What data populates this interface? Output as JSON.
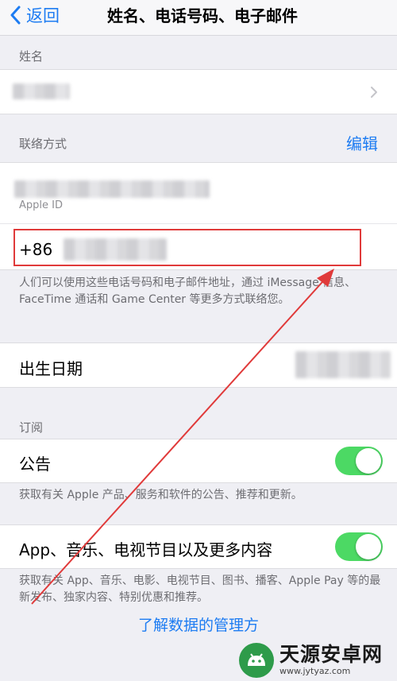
{
  "nav": {
    "back_label": "返回",
    "title": "姓名、电话号码、电子邮件"
  },
  "name_section": {
    "header": "姓名"
  },
  "contact_section": {
    "header": "联络方式",
    "edit_label": "编辑",
    "apple_id_label": "Apple ID",
    "phone_prefix": "+86",
    "footnote": "人们可以使用这些电话号码和电子邮件地址，通过 iMessage 信息、FaceTime 通话和 Game Center 等更多方式联络您。"
  },
  "birthday": {
    "label": "出生日期"
  },
  "subscription_section": {
    "header": "订阅",
    "announcements": {
      "label": "公告",
      "enabled": true,
      "footnote": "获取有关 Apple 产品、服务和软件的公告、推荐和更新。"
    },
    "apps_music": {
      "label": "App、音乐、电视节目以及更多内容",
      "enabled": true,
      "footnote": "获取有关 App、音乐、电影、电视节目、图书、播客、Apple Pay 等的最新发布、独家内容、特别优惠和推荐。"
    }
  },
  "data_link": {
    "label": "了解数据的管理方"
  },
  "watermark": {
    "name": "天源安卓网",
    "url": "www.jytyaz.com"
  },
  "colors": {
    "accent": "#1d7cf2",
    "toggle_on": "#4cd964",
    "annotation": "#e03a3a",
    "background": "#efeff4"
  },
  "icons": [
    "chevron-left-icon",
    "chevron-right-icon"
  ]
}
